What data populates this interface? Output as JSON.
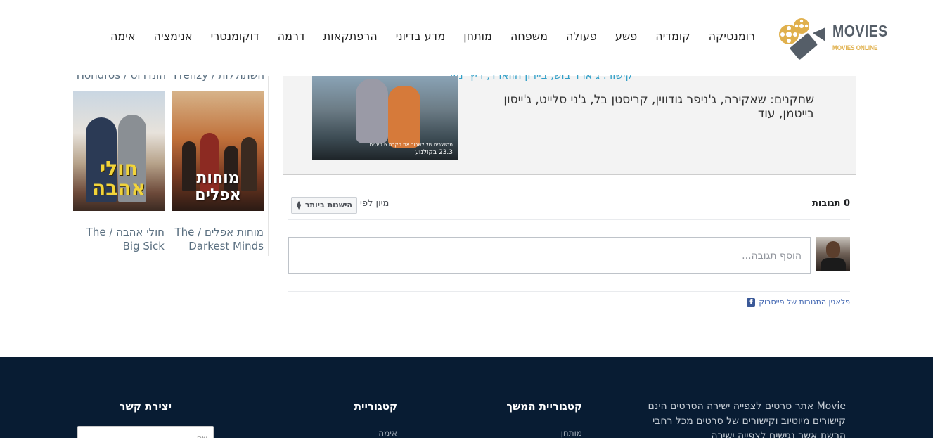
{
  "header": {
    "logo_word": "MOVIES",
    "logo_sub": "MOVIES ONLINE",
    "nav": [
      "אימה",
      "אנימציה",
      "דוקומנטרי",
      "דרמה",
      "הרפתקאות",
      "מדע בדיוני",
      "מותחן",
      "משפחה",
      "פעולה",
      "פשע",
      "קומדיה",
      "רומנטיקה"
    ]
  },
  "sidebar": {
    "top_title_1": "Hondros / הונדרוס",
    "top_title_2": "Frenzy / השתוללות",
    "posters": [
      {
        "poster_text": "חולי אהבה",
        "caption": "חולי אהבה / The Big Sick"
      },
      {
        "poster_text": "מוחות אפלים",
        "caption": "מוחות אפלים / The Darkest Minds"
      }
    ]
  },
  "movie": {
    "cut_line": "קישור: ג'ארד בוש, ביירון הווארד, ריץ' מור",
    "cast": "שחקנים: שאקירה, ג'ניפר גודווין, קריסטן בל, ג'ני סלייט, ג'ייסון בייטמן, עוד",
    "poster_line1": "23.3 בקולנוע",
    "poster_line2": "מהיוצרים של לשבור את הקרח 6 ג'ינגים"
  },
  "comments": {
    "count": "0 תגובות",
    "sort_label": "מיון לפי",
    "sort_value": "הישנות ביותר",
    "input_placeholder": "הוסף תגובה...",
    "plugin_link": "פלאגין התגובות של פייסבוק"
  },
  "footer": {
    "about": "Movie אתר סרטים לצפייה ישירה הסרטים הינם קישורים מיוטיוב וקישורים של סרטים מכל רחבי הרשת אשר נגישים לצפייה ישירה",
    "heading_categories": "קטגוריית",
    "heading_categories_cont": "קטגוריית המשך",
    "heading_contact": "יצירת קשר",
    "link_categories": "אימה",
    "link_categories_cont": "מותחן",
    "contact_placeholder": "שם"
  },
  "colors": {
    "footer_bg": "#081c33",
    "logo_accent": "#e0b04c",
    "link_blue": "#4267b2"
  }
}
